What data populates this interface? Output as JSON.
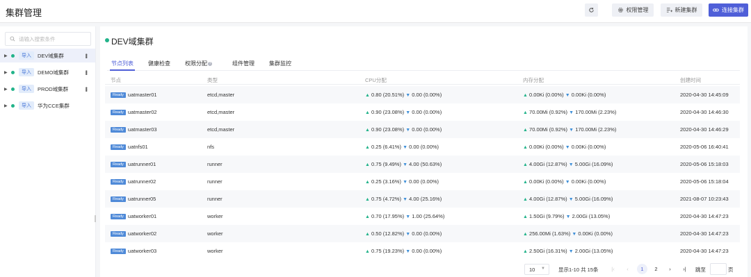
{
  "header": {
    "title": "集群管理",
    "refresh_icon": "refresh-icon",
    "permission_label": "权限管理",
    "create_label": "新建集群",
    "connect_label": "连接集群",
    "accent_color": "#4f5fd8"
  },
  "sidebar": {
    "search_placeholder": "请输入搜索条件",
    "import_tag": "导入",
    "items": [
      {
        "label": "DEV域集群",
        "active": true
      },
      {
        "label": "DEMO域集群",
        "active": false
      },
      {
        "label": "PROD域集群",
        "active": false
      },
      {
        "label": "华为CCE集群",
        "active": false
      }
    ]
  },
  "main": {
    "title": "DEV域集群",
    "tabs": [
      {
        "label": "节点列表",
        "active": true
      },
      {
        "label": "健康检查",
        "active": false
      },
      {
        "label": "权限分配",
        "active": false
      },
      {
        "label": "组件管理",
        "active": false
      },
      {
        "label": "集群监控",
        "active": false
      }
    ],
    "tab_info_icon": "info-icon",
    "columns": [
      "节点",
      "类型",
      "CPU分配",
      "内存分配",
      "创建时间"
    ],
    "status_label": "Ready",
    "rows": [
      {
        "node": "uatmaster01",
        "type": "etcd,master",
        "cpu_up": "0.80 (20.51%)",
        "cpu_down": "0.00 (0.00%)",
        "mem_up": "0.00Ki (0.00%)",
        "mem_down": "0.00Ki (0.00%)",
        "created": "2020-04-30 14:45:09"
      },
      {
        "node": "uatmaster02",
        "type": "etcd,master",
        "cpu_up": "0.90 (23.08%)",
        "cpu_down": "0.00 (0.00%)",
        "mem_up": "70.00Mi (0.92%)",
        "mem_down": "170.00Mi (2.23%)",
        "created": "2020-04-30 14:46:30"
      },
      {
        "node": "uatmaster03",
        "type": "etcd,master",
        "cpu_up": "0.90 (23.08%)",
        "cpu_down": "0.00 (0.00%)",
        "mem_up": "70.00Mi (0.92%)",
        "mem_down": "170.00Mi (2.23%)",
        "created": "2020-04-30 14:46:29"
      },
      {
        "node": "uatnfs01",
        "type": "nfs",
        "cpu_up": "0.25 (6.41%)",
        "cpu_down": "0.00 (0.00%)",
        "mem_up": "0.00Ki (0.00%)",
        "mem_down": "0.00Ki (0.00%)",
        "created": "2020-05-06 16:40:41"
      },
      {
        "node": "uatrunner01",
        "type": "runner",
        "cpu_up": "0.75 (9.49%)",
        "cpu_down": "4.00 (50.63%)",
        "mem_up": "4.00Gi (12.87%)",
        "mem_down": "5.00Gi (16.09%)",
        "created": "2020-05-06 15:18:03"
      },
      {
        "node": "uatrunner02",
        "type": "runner",
        "cpu_up": "0.25 (3.16%)",
        "cpu_down": "0.00 (0.00%)",
        "mem_up": "0.00Ki (0.00%)",
        "mem_down": "0.00Ki (0.00%)",
        "created": "2020-05-06 15:18:04"
      },
      {
        "node": "uatrunner05",
        "type": "runner",
        "cpu_up": "0.75 (4.72%)",
        "cpu_down": "4.00 (25.16%)",
        "mem_up": "4.00Gi (12.87%)",
        "mem_down": "5.00Gi (16.09%)",
        "created": "2021-08-07 10:23:43"
      },
      {
        "node": "uatworker01",
        "type": "worker",
        "cpu_up": "0.70 (17.95%)",
        "cpu_down": "1.00 (25.64%)",
        "mem_up": "1.50Gi (9.79%)",
        "mem_down": "2.00Gi (13.05%)",
        "created": "2020-04-30 14:47:23"
      },
      {
        "node": "uatworker02",
        "type": "worker",
        "cpu_up": "0.50 (12.82%)",
        "cpu_down": "0.00 (0.00%)",
        "mem_up": "256.00Mi (1.63%)",
        "mem_down": "0.00Ki (0.00%)",
        "created": "2020-04-30 14:47:23"
      },
      {
        "node": "uatworker03",
        "type": "worker",
        "cpu_up": "0.75 (19.23%)",
        "cpu_down": "0.00 (0.00%)",
        "mem_up": "2.50Gi (16.31%)",
        "mem_down": "2.00Gi (13.05%)",
        "created": "2020-04-30 14:47:23"
      }
    ]
  },
  "pagination": {
    "page_size": "10",
    "summary": "显示1-10 共 15条",
    "pages": [
      "1",
      "2"
    ],
    "current_page": "1",
    "goto_label": "跳至",
    "page_unit": "页"
  }
}
